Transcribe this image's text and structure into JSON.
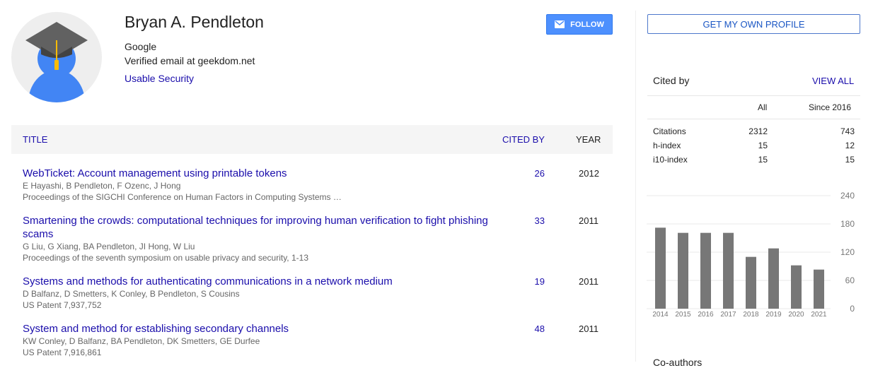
{
  "profile": {
    "name": "Bryan A. Pendleton",
    "affiliation": "Google",
    "email": "Verified email at geekdom.net",
    "interest": "Usable Security",
    "follow_label": "FOLLOW"
  },
  "table": {
    "headers": {
      "title": "TITLE",
      "cited_by": "CITED BY",
      "year": "YEAR"
    },
    "rows": [
      {
        "title": "WebTicket: Account management using printable tokens",
        "authors": "E Hayashi, B Pendleton, F Ozenc, J Hong",
        "venue": "Proceedings of the SIGCHI Conference on Human Factors in Computing Systems …",
        "cited_by": "26",
        "year": "2012"
      },
      {
        "title": "Smartening the crowds: computational techniques for improving human verification to fight phishing scams",
        "authors": "G Liu, G Xiang, BA Pendleton, JI Hong, W Liu",
        "venue": "Proceedings of the seventh symposium on usable privacy and security, 1-13",
        "cited_by": "33",
        "year": "2011"
      },
      {
        "title": "Systems and methods for authenticating communications in a network medium",
        "authors": "D Balfanz, D Smetters, K Conley, B Pendleton, S Cousins",
        "venue": "US Patent 7,937,752",
        "cited_by": "19",
        "year": "2011"
      },
      {
        "title": "System and method for establishing secondary channels",
        "authors": "KW Conley, D Balfanz, BA Pendleton, DK Smetters, GE Durfee",
        "venue": "US Patent 7,916,861",
        "cited_by": "48",
        "year": "2011"
      }
    ]
  },
  "sidebar": {
    "get_profile_label": "GET MY OWN PROFILE",
    "cited_by_title": "Cited by",
    "view_all_label": "VIEW ALL",
    "col_all": "All",
    "col_since": "Since 2016",
    "stats": [
      {
        "label": "Citations",
        "all": "2312",
        "since": "743"
      },
      {
        "label": "h-index",
        "all": "15",
        "since": "12"
      },
      {
        "label": "i10-index",
        "all": "15",
        "since": "15"
      }
    ],
    "coauthors_label": "Co-authors"
  },
  "chart_data": {
    "type": "bar",
    "categories": [
      "2014",
      "2015",
      "2016",
      "2017",
      "2018",
      "2019",
      "2020",
      "2021"
    ],
    "values": [
      172,
      161,
      161,
      161,
      110,
      128,
      92,
      83
    ],
    "yticks": [
      "0",
      "60",
      "120",
      "180",
      "240"
    ],
    "ylim": [
      0,
      240
    ],
    "grid": true,
    "bar_color": "#777777"
  },
  "colors": {
    "link": "#1a0dab",
    "follow_button": "#4d90fe",
    "header_bg": "#f5f5f5"
  },
  "icons": {
    "follow": "envelope-icon",
    "avatar": "graduate-cap-avatar"
  }
}
